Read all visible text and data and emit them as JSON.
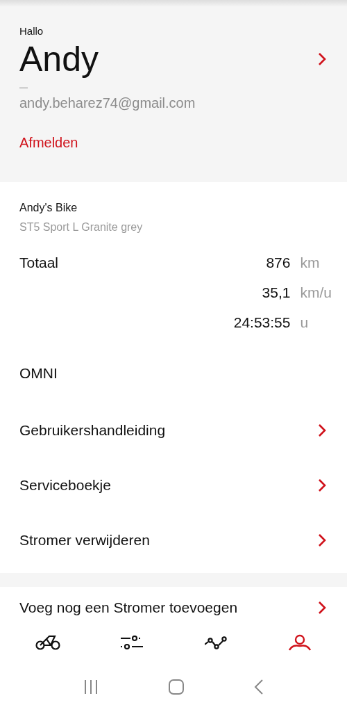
{
  "account": {
    "greeting": "Hallo",
    "name": "Andy",
    "email": "andy.beharez74@gmail.com",
    "logout": "Afmelden"
  },
  "bike": {
    "name": "Andy's Bike",
    "model": "ST5 Sport L Granite grey",
    "totals_label": "Totaal",
    "stats": [
      {
        "value": "876",
        "unit": "km"
      },
      {
        "value": "35,1",
        "unit": "km/u"
      },
      {
        "value": "24:53:55",
        "unit": "u"
      }
    ]
  },
  "section_title": "OMNI",
  "menu": [
    {
      "label": "Gebruikershandleiding"
    },
    {
      "label": "Serviceboekje"
    },
    {
      "label": "Stromer verwijderen"
    }
  ],
  "extra_menu": [
    {
      "label": "Voeg nog een Stromer toevoegen"
    }
  ],
  "tabs": [
    {
      "kind": "bike",
      "selected": false
    },
    {
      "kind": "settings",
      "selected": false
    },
    {
      "kind": "route",
      "selected": false
    },
    {
      "kind": "profile",
      "selected": true
    }
  ]
}
